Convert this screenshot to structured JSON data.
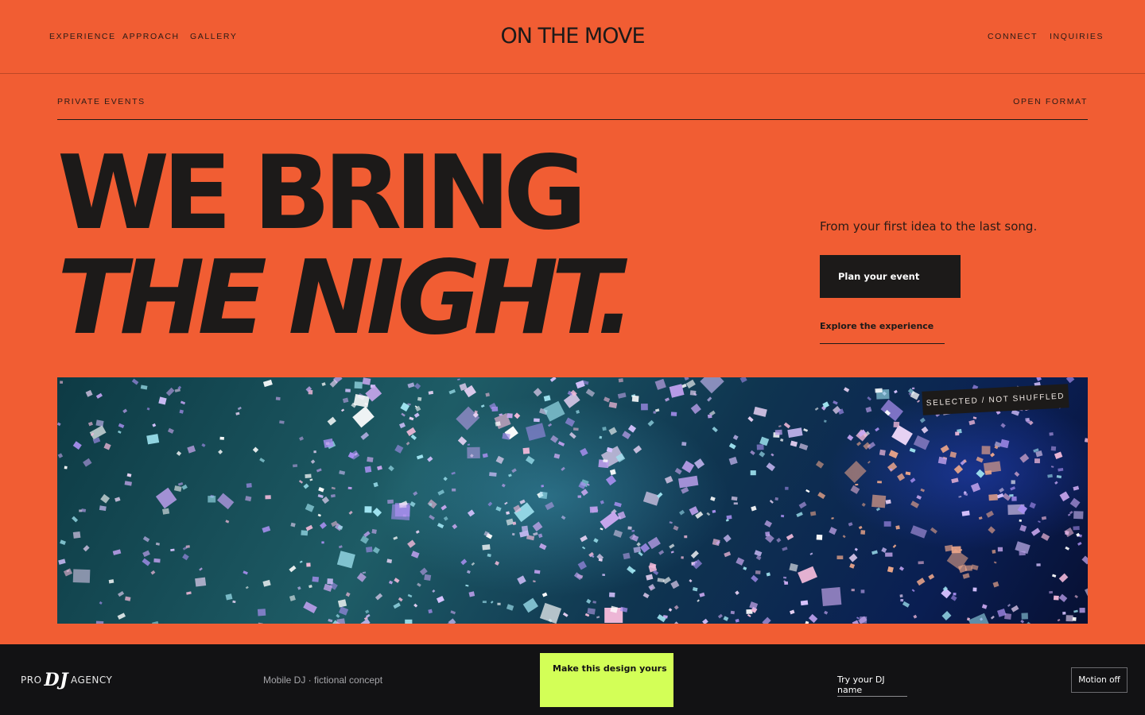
{
  "header": {
    "brand": "ON THE MOVE",
    "nav_left": [
      "EXPERIENCE",
      "APPROACH",
      "GALLERY"
    ],
    "nav_right": [
      "CONNECT",
      "INQUIRIES"
    ]
  },
  "subheader": {
    "left": "PRIVATE EVENTS",
    "right": "OPEN FORMAT"
  },
  "hero": {
    "line1": "WE BRING",
    "line2": "THE NIGHT.",
    "tagline": "From your first idea to the last song.",
    "cta_primary": "Plan your event",
    "cta_secondary": "Explore the experience"
  },
  "photo": {
    "badge": "SELECTED / NOT SHUFFLED",
    "subject": "confetti-falling-photo"
  },
  "footer": {
    "logo_left": "PRO",
    "logo_mid": "DJ",
    "logo_right": "AGENCY",
    "concept": "Mobile DJ · fictional concept",
    "make_label": "Make this design yours",
    "try_label": "Try your DJ name",
    "motion_label": "Motion off"
  },
  "colors": {
    "background": "#f15d33",
    "ink": "#1c1a19",
    "footer_bg": "#121214",
    "accent_lime": "#d3ff57"
  }
}
